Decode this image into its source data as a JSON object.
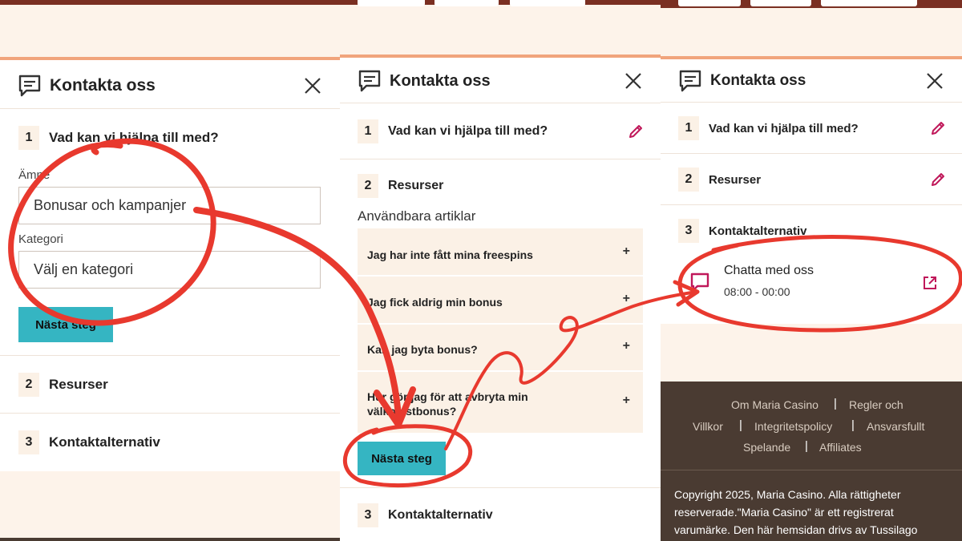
{
  "header": {
    "title": "Kontakta oss"
  },
  "steps": {
    "s1": {
      "num": "1",
      "label": "Vad kan vi hjälpa till med?"
    },
    "s2": {
      "num": "2",
      "label": "Resurser"
    },
    "s3": {
      "num": "3",
      "label": "Kontaktalternativ"
    }
  },
  "form": {
    "subject_label": "Ämne",
    "subject_value": "Bonusar och kampanjer",
    "category_label": "Kategori",
    "category_value": "Välj en kategori",
    "next_button": "Nästa steg"
  },
  "resources": {
    "subtitle": "Användbara artiklar",
    "articles": [
      {
        "line1": "Jag har inte fått mina freespins",
        "line2": ""
      },
      {
        "line1": "Jag fick aldrig min bonus",
        "line2": ""
      },
      {
        "line1": "Kan jag byta bonus?",
        "line2": ""
      },
      {
        "line1": "Hur gör jag för att avbryta min",
        "line2": "välkomstbonus?"
      }
    ],
    "expand_symbol": "+",
    "next_button": "Nästa steg"
  },
  "contact": {
    "chat_title": "Chatta med oss",
    "chat_hours": "08:00 - 00:00"
  },
  "footer": {
    "links": [
      "Om Maria Casino",
      "Regler och Villkor",
      "Integritetspolicy",
      "Ansvarsfullt Spelande",
      "Affiliates"
    ],
    "om": "Om Maria Casino",
    "regler1": "Regler och",
    "regler2": "Villkor",
    "integritet": "Integritetspolicy",
    "ansvar1": "Ansvarsfullt",
    "ansvar2": "Spelande",
    "affiliates": "Affiliates",
    "separator": "|",
    "copyright": "Copyright 2025, Maria Casino. Alla rättigheter reserverade.\"Maria Casino\" är ett registrerat varumärke. Den här hemsidan drivs av Tussilago"
  },
  "colors": {
    "accent_button": "#35b5c2",
    "annotation_red": "#e8392e",
    "pencil_pink": "#c0185a",
    "footer_bg": "#4a3b32",
    "page_bg": "#fdf3ea"
  },
  "icons": [
    "chat-bubble-icon",
    "close-icon",
    "pencil-icon",
    "plus-icon",
    "external-link-icon"
  ]
}
